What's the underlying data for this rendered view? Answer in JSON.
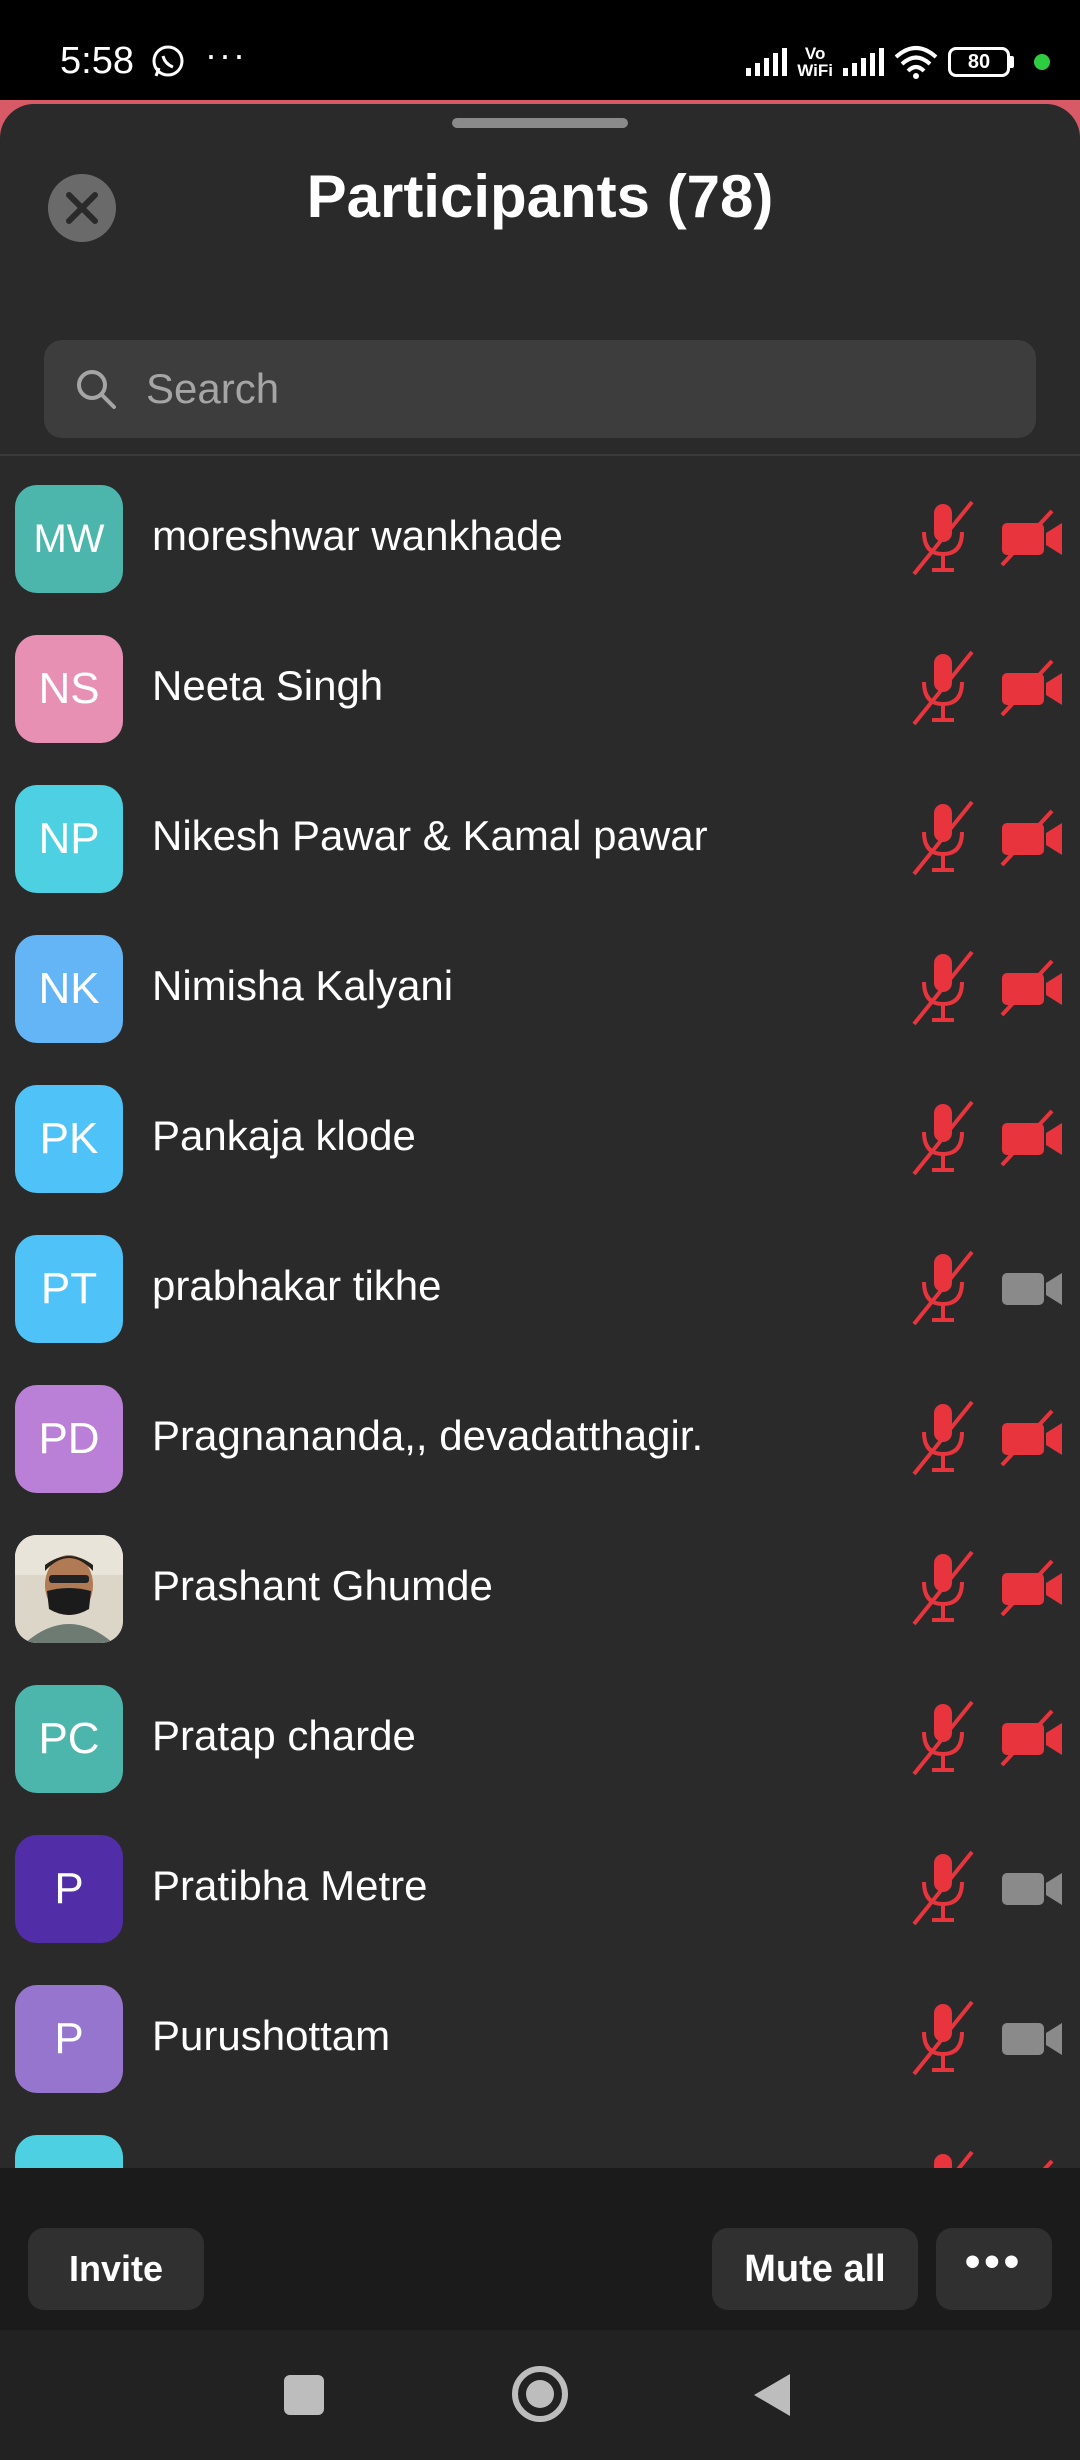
{
  "status_bar": {
    "time": "5:58",
    "notification_icons": [
      "whatsapp-icon",
      "more-dots"
    ],
    "more_dots": "···",
    "vowifi_line1": "Vo",
    "vowifi_line2": "WiFi",
    "battery": "80"
  },
  "sheet": {
    "title": "Participants (78)",
    "search_placeholder": "Search"
  },
  "colors": {
    "muted_red": "#e8343c",
    "camera_on_gray": "#8a8a8a"
  },
  "participants": [
    {
      "initials": "MW",
      "name": "moreshwar wankhade",
      "color": "#4db6ac",
      "mic_muted": true,
      "video_off": true
    },
    {
      "initials": "NS",
      "name": "Neeta Singh",
      "color": "#e88fb4",
      "mic_muted": true,
      "video_off": true
    },
    {
      "initials": "NP",
      "name": "Nikesh Pawar & Kamal pawar",
      "color": "#4dd0e1",
      "mic_muted": true,
      "video_off": true
    },
    {
      "initials": "NK",
      "name": "Nimisha Kalyani",
      "color": "#64b5f6",
      "mic_muted": true,
      "video_off": true
    },
    {
      "initials": "PK",
      "name": "Pankaja klode",
      "color": "#4fc3f7",
      "mic_muted": true,
      "video_off": true
    },
    {
      "initials": "PT",
      "name": "prabhakar tikhe",
      "color": "#4fc3f7",
      "mic_muted": true,
      "video_off": false
    },
    {
      "initials": "PD",
      "name": "Pragnananda,, devadatthagir.",
      "color": "#ba80d8",
      "mic_muted": true,
      "video_off": true
    },
    {
      "initials": "",
      "name": "Prashant Ghumde",
      "color": "#c9c0b0",
      "photo": true,
      "mic_muted": true,
      "video_off": true
    },
    {
      "initials": "PC",
      "name": "Pratap charde",
      "color": "#4db6ac",
      "mic_muted": true,
      "video_off": true
    },
    {
      "initials": "P",
      "name": "Pratibha Metre",
      "color": "#512da8",
      "mic_muted": true,
      "video_off": false
    },
    {
      "initials": "P",
      "name": "Purushottam",
      "color": "#9575cd",
      "mic_muted": true,
      "video_off": false
    },
    {
      "initials": "",
      "name": "",
      "color": "#4dd0e1",
      "mic_muted": true,
      "video_off": true
    }
  ],
  "bottom_bar": {
    "invite_label": "Invite",
    "mute_all_label": "Mute all",
    "more_label": "•••"
  }
}
